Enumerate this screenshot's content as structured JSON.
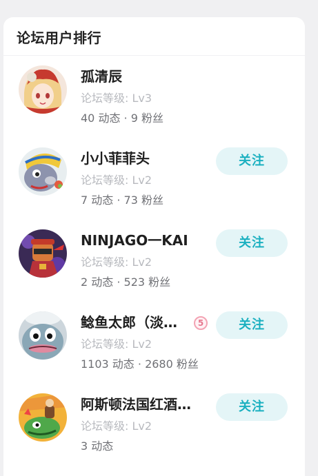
{
  "panel": {
    "title": "论坛用户排行"
  },
  "users": [
    {
      "name": "孤清辰",
      "level": "论坛等级: Lv3",
      "stats": "40 动态 · 9 粉丝",
      "follow_label": ""
    },
    {
      "name": "小小菲菲头",
      "level": "论坛等级: Lv2",
      "stats": "7 动态 · 73 粉丝",
      "follow_label": "关注"
    },
    {
      "name": "NINJAGO一KAI",
      "level": "论坛等级: Lv2",
      "stats": "2 动态 · 523 粉丝",
      "follow_label": "关注"
    },
    {
      "name": "鲶鱼太郎（淡…",
      "level": "论坛等级: Lv2",
      "stats": "1103 动态 · 2680 粉丝",
      "follow_label": "关注",
      "badge": "5"
    },
    {
      "name": "阿斯顿法国红酒…",
      "level": "论坛等级: Lv2",
      "stats": "3 动态",
      "follow_label": "关注"
    }
  ]
}
